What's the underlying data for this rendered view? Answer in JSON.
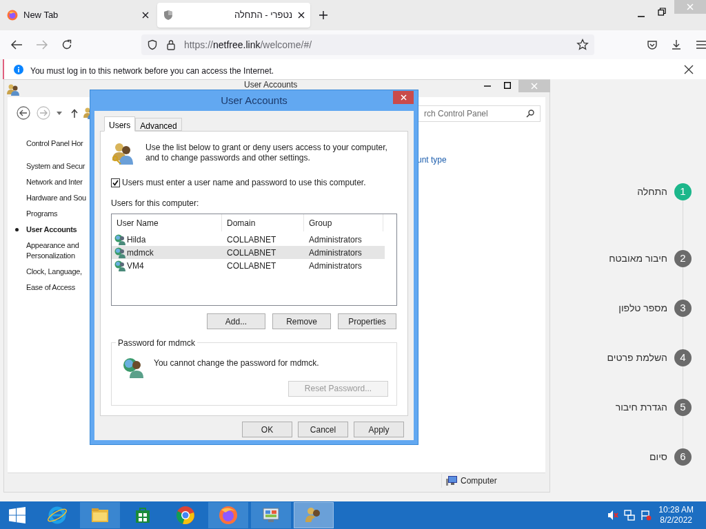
{
  "browser": {
    "tabs": [
      {
        "label": "New Tab",
        "kind": "firefox",
        "selected": false
      },
      {
        "label": "נטפרי - התחלה",
        "kind": "shield",
        "selected": true
      }
    ],
    "url": {
      "scheme": "https://",
      "host": "netfree.link",
      "path": "/welcome/#/"
    },
    "notification": "You must log in to this network before you can access the Internet."
  },
  "control_panel": {
    "title": "User Accounts",
    "search_placeholder": "rch Control Panel",
    "nav": [
      {
        "label": "Control Panel Hor",
        "selected": false
      },
      {
        "label": "System and Secur",
        "selected": false
      },
      {
        "label": "Network and Inter",
        "selected": false
      },
      {
        "label": "Hardware and Sou",
        "selected": false
      },
      {
        "label": "Programs",
        "selected": false
      },
      {
        "label": "User Accounts",
        "selected": true
      },
      {
        "label": "Appearance and Personalization",
        "selected": false
      },
      {
        "label": "Clock, Language,",
        "selected": false
      },
      {
        "label": "Ease of Access",
        "selected": false
      }
    ],
    "link": "unt type",
    "status": "Computer"
  },
  "dialog": {
    "title": "User Accounts",
    "tabs": [
      {
        "label": "Users",
        "selected": true
      },
      {
        "label": "Advanced",
        "selected": false
      }
    ],
    "intro": "Use the list below to grant or deny users access to your computer, and to change passwords and other settings.",
    "checkbox": {
      "label": "Users must enter a user name and password to use this computer.",
      "checked": true
    },
    "list_label": "Users for this computer:",
    "columns": [
      "User Name",
      "Domain",
      "Group"
    ],
    "rows": [
      {
        "cells": [
          "Hilda",
          "COLLABNET",
          "Administrators"
        ],
        "selected": false
      },
      {
        "cells": [
          "mdmck",
          "COLLABNET",
          "Administrators"
        ],
        "selected": true
      },
      {
        "cells": [
          "VM4",
          "COLLABNET",
          "Administrators"
        ],
        "selected": false
      }
    ],
    "list_buttons": [
      "Add...",
      "Remove",
      "Properties"
    ],
    "password": {
      "title": "Password for mdmck",
      "message": "You cannot change the password for mdmck.",
      "button": {
        "label": "Reset Password...",
        "disabled": true
      }
    },
    "footer_buttons": [
      "OK",
      "Cancel",
      "Apply"
    ]
  },
  "steps": [
    {
      "number": "1",
      "label": "התחלה",
      "selected": true
    },
    {
      "number": "2",
      "label": "חיבור מאובטח",
      "selected": false
    },
    {
      "number": "3",
      "label": "מספר טלפון",
      "selected": false
    },
    {
      "number": "4",
      "label": "השלמת פרטים",
      "selected": false
    },
    {
      "number": "5",
      "label": "הגדרת חיבור",
      "selected": false
    },
    {
      "number": "6",
      "label": "סיום",
      "selected": false
    }
  ],
  "taskbar": {
    "apps": [
      {
        "kind": "ie",
        "selected": false
      },
      {
        "kind": "explorer",
        "selected": false
      },
      {
        "kind": "store",
        "selected": false
      },
      {
        "kind": "chrome",
        "selected": false
      },
      {
        "kind": "firefox",
        "selected": false
      },
      {
        "kind": "control_panel",
        "selected": false
      },
      {
        "kind": "users",
        "selected": true
      }
    ],
    "time": "10:28 AM",
    "date": "8/2/2022"
  }
}
